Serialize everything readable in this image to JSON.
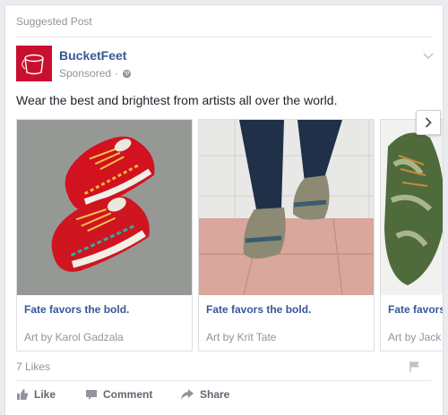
{
  "header": {
    "suggested_label": "Suggested Post"
  },
  "page": {
    "name": "BucketFeet",
    "sponsored_label": "Sponsored",
    "separator": "·",
    "globe_icon": "globe-icon"
  },
  "message": "Wear the best and brightest from artists all over the world.",
  "carousel": {
    "cards": [
      {
        "title": "Fate favors the bold.",
        "description": "Art by Karol Gadzala"
      },
      {
        "title": "Fate favors the bold.",
        "description": "Art by Krit Tate"
      },
      {
        "title": "Fate favors the bold.",
        "description": "Art by Jack"
      }
    ],
    "next_icon": "chevron-right-icon"
  },
  "footer": {
    "likes_text": "7 Likes",
    "actions": {
      "like": "Like",
      "comment": "Comment",
      "share": "Share"
    }
  },
  "colors": {
    "brand_red": "#c8102e",
    "link_blue": "#365899",
    "muted_gray": "#90949c"
  }
}
